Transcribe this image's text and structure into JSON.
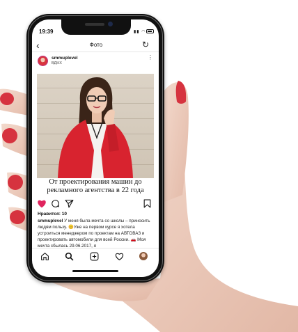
{
  "status": {
    "time": "19:39"
  },
  "nav": {
    "title": "Фото",
    "back_icon": "chevron-left-icon",
    "refresh_icon": "refresh-icon"
  },
  "post": {
    "username": "smmuplevel",
    "location": "ВДНХ",
    "photo_caption_line1": "От проектирования машин до",
    "photo_caption_line2": "рекламного агентства в 22 года",
    "likes": "Нравится: 10",
    "caption_user": "smmuplevel",
    "caption_text": "У меня была мечта со школы – приносить людям пользу. 😊Уже на первом курсе я хотела устроиться менеджером по проектам на АВТОВАЗ и проектировать автомобили для всей России. 🚗 Моя мечта сбылась 29.06.2017, я"
  },
  "tabbar": {
    "items": [
      "home",
      "search",
      "add",
      "activity",
      "profile"
    ]
  },
  "colors": {
    "heart": "#e0245e",
    "nail": "#d6333f",
    "phone": "#111111"
  }
}
